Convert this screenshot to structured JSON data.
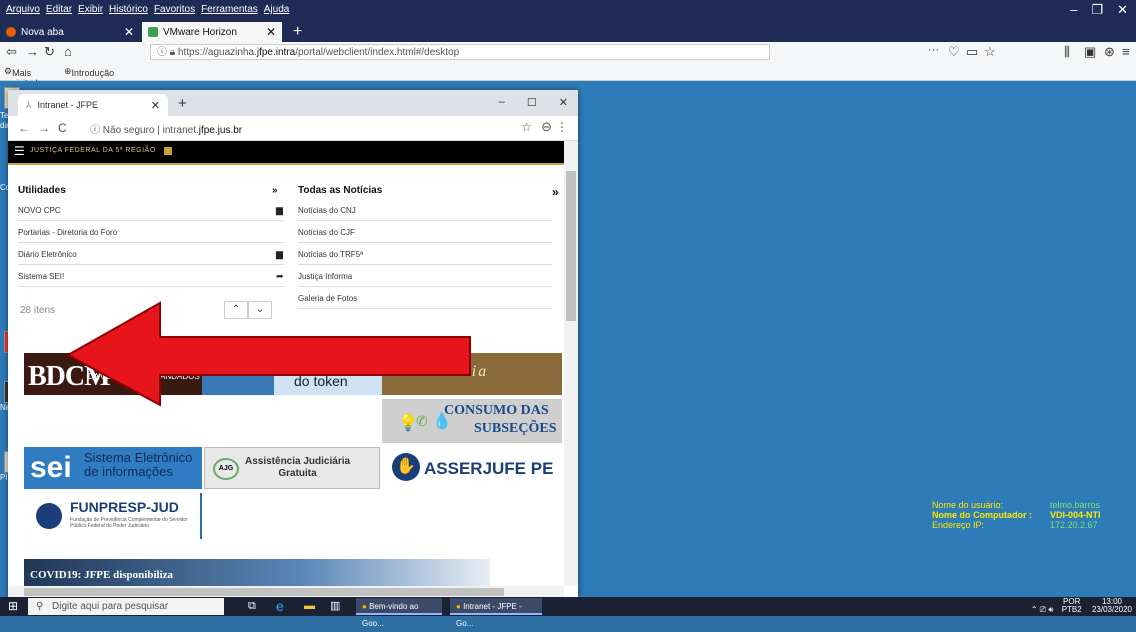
{
  "outer_browser": {
    "menu": [
      "Arquivo",
      "Editar",
      "Exibir",
      "Histórico",
      "Favoritos",
      "Ferramentas",
      "Ajuda"
    ],
    "tabs": [
      {
        "label": "Nova aba",
        "active": false
      },
      {
        "label": "VMware Horizon",
        "active": true
      }
    ],
    "url_prefix": "https://aguazinha.",
    "url_host": "jfpe.intra",
    "url_suffix": "/portal/webclient/index.html#/desktop",
    "bookmarks": [
      "Mais visitados",
      "Introdução"
    ]
  },
  "inner_browser": {
    "tab_label": "Intranet - JFPE",
    "security": "Não seguro",
    "url_prefix": "intranet.",
    "url_host": "jfpe.jus.br"
  },
  "site": {
    "brand": "JUSTIÇA FEDERAL DA 5ª REGIÃO",
    "utilidades_title": "Utilidades",
    "noticias_title": "Todas as Notícias",
    "utilidades": [
      "NOVO CPC",
      "Portarias - Diretoria do Foro",
      "Diário Eletrônico",
      "Sistema SEI!"
    ],
    "noticias": [
      "Notícias do CNJ",
      "Notícias do CJF",
      "Notícias do TRF5ª",
      "Justiça Informa",
      "Galeria de Fotos"
    ],
    "itens_count": "28 itens",
    "banners": {
      "bdcm_big": "BDCM",
      "bdcm_small1": "BANCO DE",
      "bdcm_small2": "DA CENTRAL DE MANDADOS",
      "token": "do token",
      "memoria": "mória",
      "consumo1": "CONSUMO DAS",
      "consumo2": "SUBSEÇÕES",
      "sei_big": "sei",
      "sei_small1": "Sistema Eletrônico",
      "sei_small2": "de informações",
      "ajg1": "Assistência Judiciária",
      "ajg2": "Gratuita",
      "ajg_logo": "AJG",
      "asser": "ASSERJUFE PE",
      "funpresp": "FUNPRESP-JUD",
      "funpresp_sub": "Fundação de Previdência Complementar do Servidor Público Federal do Poder Judiciário",
      "covid": "COVID19: JFPE disponibiliza"
    }
  },
  "desktop_info": {
    "user_label": "Nome do usuário:",
    "user_value": "telmo.barros",
    "computer_label": "Nome do Computador :",
    "computer_value": "VDI-004-NTI",
    "ip_label": "Endereço IP:",
    "ip_value": "172.20.2.67"
  },
  "desktop_labels": [
    "Telm",
    "da R",
    "Co",
    "Ne",
    "Pl"
  ],
  "taskbar": {
    "search_placeholder": "Digite aqui para pesquisar",
    "apps": [
      "Bem-vindo ao Goo...",
      "Intranet - JFPE - Go..."
    ],
    "lang": "POR",
    "lang2": "PTB2",
    "time": "13:00",
    "date": "23/03/2020"
  },
  "colors": {
    "arrow": "#e8141b",
    "accent": "#c9a23a",
    "info_label": "#ffea00",
    "info_value": "#7ee16b"
  }
}
